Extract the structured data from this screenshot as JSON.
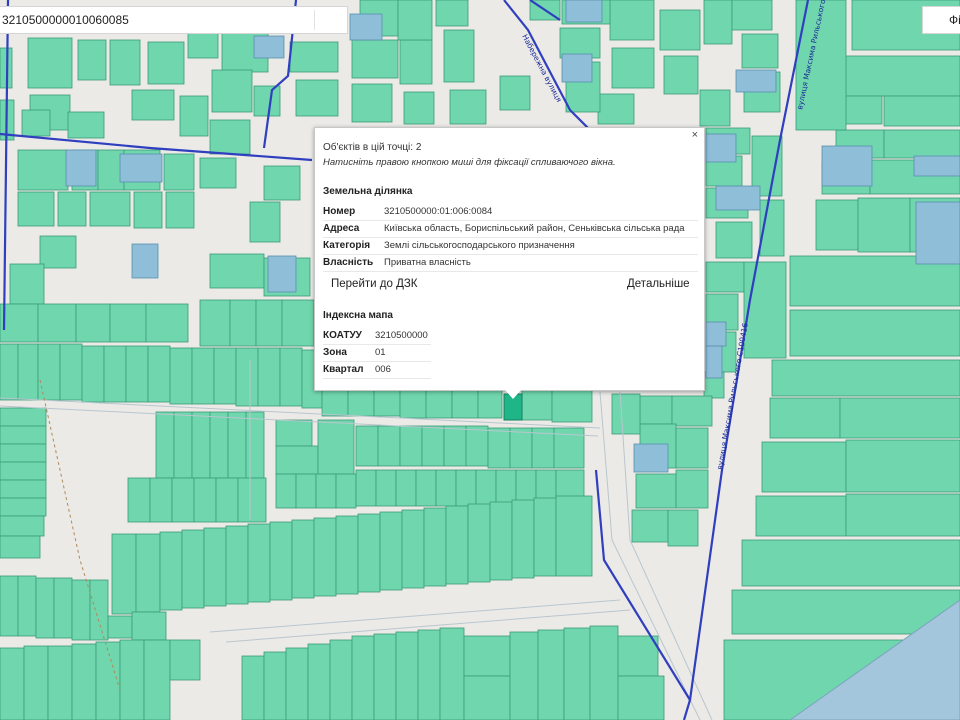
{
  "search": {
    "value": "3210500000010060085"
  },
  "top_right_button": {
    "label": "Фільтр"
  },
  "streets": [
    {
      "name": "вулиця Максима Рильського С100416"
    },
    {
      "name": "вулиця Максима Рильського"
    },
    {
      "name": "Набережна вулиця"
    }
  ],
  "popup": {
    "close": "×",
    "objects_count": "Об'єктів в цій точці: 2",
    "hint": "Натисніть правою кнопкою миші для фіксації спливаючого вікна.",
    "parcel": {
      "title": "Земельна ділянка",
      "rows": [
        {
          "key": "Номер",
          "value": "3210500000:01:006:0084"
        },
        {
          "key": "Адреса",
          "value": "Київська область, Бориспільський район, Сеньківська сільська рада"
        },
        {
          "key": "Категорія",
          "value": "Землі сільськогосподарського призначення"
        },
        {
          "key": "Власність",
          "value": "Приватна власність"
        }
      ],
      "go_to_dzk": "Перейти до ДЗК",
      "details": "Детальніше"
    },
    "index_map": {
      "title": "Індексна мапа",
      "rows": [
        {
          "key": "КОАТУУ",
          "value": "3210500000"
        },
        {
          "key": "Зона",
          "value": "01"
        },
        {
          "key": "Квартал",
          "value": "006"
        }
      ]
    }
  },
  "colors": {
    "parcel_fill": "#6fd6ad",
    "parcel_stroke": "#3d9c78",
    "parcel_state": "#8ebed8",
    "selected_parcel": "#1fb586",
    "road_line": "#2f3fbf",
    "background": "#ebeae6",
    "water": "#a4c6dc"
  }
}
